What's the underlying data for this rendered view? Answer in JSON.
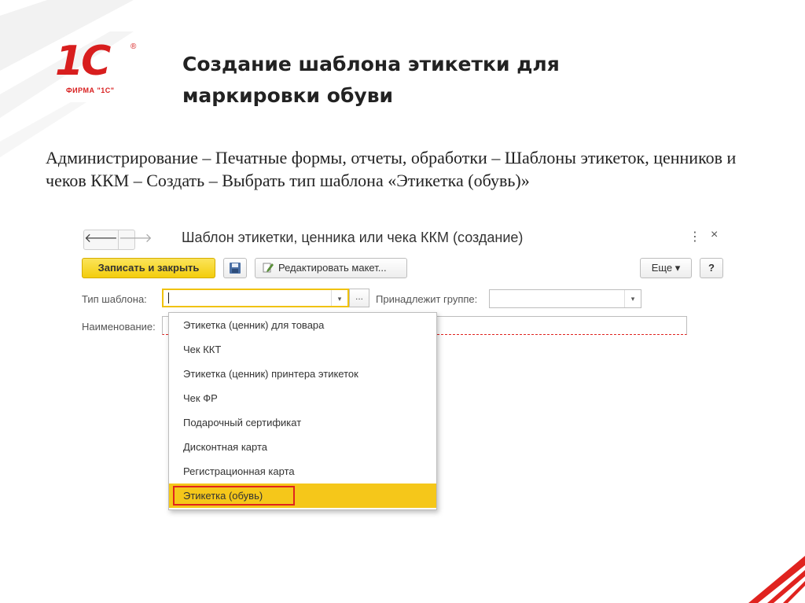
{
  "logo": {
    "mark": "1С",
    "registered": "®",
    "firm": "ФИРМА \"1С\""
  },
  "slide": {
    "title": "Создание шаблона этикетки для маркировки обуви",
    "path": "Администрирование – Печатные формы, отчеты, обработки – Шаблоны этикеток, ценников и чеков ККМ – Создать – Выбрать тип шаблона «Этикетка (обувь)»"
  },
  "window": {
    "back": "🡐",
    "forward": "🡒",
    "title": "Шаблон этикетки, ценника или чека ККМ (создание)",
    "more_icon": "⋮",
    "close_icon": "×"
  },
  "toolbar": {
    "save_close": "Записать и закрыть",
    "disk_icon": "🖫",
    "edit_layout": "Редактировать макет...",
    "more": "Еще ▾",
    "help": "?"
  },
  "form": {
    "template_type_label": "Тип шаблона:",
    "template_type_value": "",
    "dots": "...",
    "group_label": "Принадлежит группе:",
    "group_value": "",
    "name_label": "Наименование:",
    "arrow": "▾"
  },
  "dropdown": {
    "items": [
      "Этикетка (ценник) для товара",
      "Чек ККТ",
      "Этикетка (ценник) принтера этикеток",
      "Чек ФР",
      "Подарочный сертификат",
      "Дисконтная карта",
      "Регистрационная карта",
      "Этикетка (обувь)"
    ],
    "selected_index": 7
  },
  "colors": {
    "accent_yellow": "#f5c71a",
    "brand_red": "#d81e1e",
    "highlight_red": "#e0231f"
  }
}
